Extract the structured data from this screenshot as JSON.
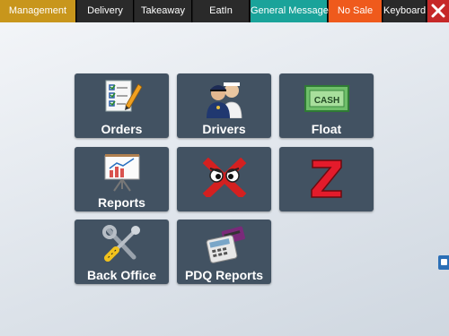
{
  "topbar": {
    "management": "Management",
    "delivery": "Delivery",
    "takeaway": "Takeaway",
    "eatin": "EatIn",
    "general_messages": "General Messages",
    "no_sale": "No Sale",
    "keyboard": "Keyboard",
    "close_icon": "close-icon"
  },
  "tiles": {
    "orders": "Orders",
    "drivers": "Drivers",
    "float": "Float",
    "float_note": "CASH",
    "reports": "Reports",
    "x_report_icon": "x-report-icon",
    "z_report_icon": "z-report-icon",
    "back_office": "Back Office",
    "pdq_reports": "PDQ Reports"
  },
  "colors": {
    "tile": "#425262",
    "management_tab": "#c8961c",
    "general_tab": "#1aa39a",
    "no_sale_tab": "#ef5a1c",
    "close_tab": "#c62828"
  }
}
